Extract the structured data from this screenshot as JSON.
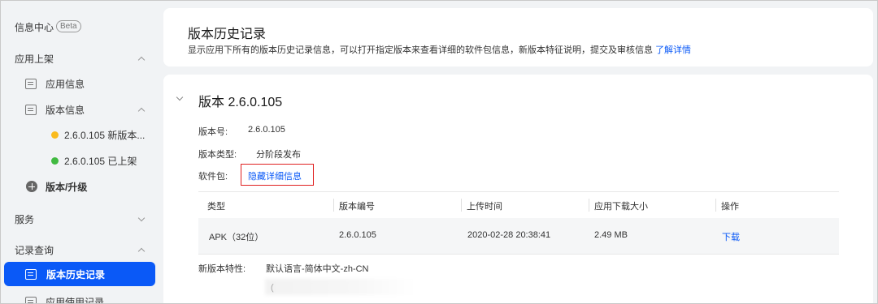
{
  "sidebar": {
    "info_center": "信息中心",
    "beta": "Beta",
    "app_release": "应用上架",
    "app_info": "应用信息",
    "version_info": "版本信息",
    "versions": [
      {
        "label": "2.6.0.105 新版本...",
        "color": "#fabb1e"
      },
      {
        "label": "2.6.0.105 已上架",
        "color": "#41ba41"
      }
    ],
    "version_upgrade": "版本/升级",
    "service": "服务",
    "record_query": "记录查询",
    "version_history": "版本历史记录",
    "app_usage": "应用使用记录"
  },
  "header": {
    "title": "版本历史记录",
    "desc": "显示应用下所有的版本历史记录信息，可以打开指定版本来查看详细的软件包信息，新版本特征说明，提交及审核信息",
    "learn_more": "了解详情"
  },
  "version": {
    "title": "版本 2.6.0.105",
    "number_label": "版本号:",
    "number_value": "2.6.0.105",
    "type_label": "版本类型:",
    "type_value": "分阶段发布",
    "package_label": "软件包:",
    "hide_details": "隐藏详细信息",
    "features_label": "新版本特性:",
    "features_value": "默认语言-简体中文-zh-CN",
    "features_extra": "（"
  },
  "table": {
    "headers": [
      "类型",
      "版本编号",
      "上传时间",
      "应用下载大小",
      "操作"
    ],
    "row": {
      "type": "APK（32位）",
      "version": "2.6.0.105",
      "upload_time": "2020-02-28 20:38:41",
      "size": "2.49 MB",
      "action": "下载"
    }
  },
  "colors": {
    "accent": "#0a59f7",
    "highlight_box": "#e02020"
  }
}
